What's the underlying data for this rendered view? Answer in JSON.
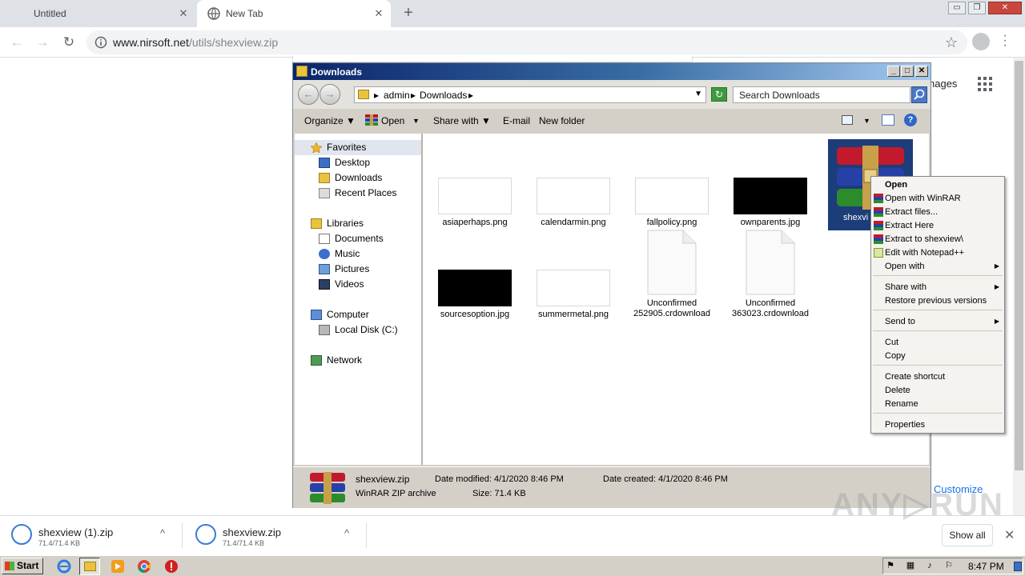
{
  "browser": {
    "tabs": [
      {
        "label": "Untitled"
      },
      {
        "label": "New Tab"
      }
    ],
    "close_glyph": "✕",
    "new_tab_glyph": "+",
    "window_buttons": {
      "minimize": "▭",
      "maximize": "❐",
      "close": "✕"
    },
    "nav": {
      "back": "←",
      "forward": "→",
      "reload": "↻",
      "star": "☆"
    },
    "url_host": "www.nirsoft.net",
    "url_path": "/utils/shexview.zip"
  },
  "ntp": {
    "images_partial": "nages",
    "customize": "Customize"
  },
  "explorer": {
    "title": "Downloads",
    "caption_buttons": {
      "minimize": "_",
      "maximize": "□",
      "close": "✕"
    },
    "breadcrumb": [
      "admin",
      "Downloads"
    ],
    "breadcrumb_sep": "▸",
    "search_placeholder": "Search Downloads",
    "commands": {
      "organize": "Organize ▼",
      "open": "Open",
      "dropdown": "▼",
      "share": "Share with ▼",
      "email": "E-mail",
      "new_folder": "New folder",
      "help": "?"
    },
    "nav": {
      "favorites": "Favorites",
      "desktop": "Desktop",
      "downloads": "Downloads",
      "recent": "Recent Places",
      "libraries": "Libraries",
      "documents": "Documents",
      "music": "Music",
      "pictures": "Pictures",
      "videos": "Videos",
      "computer": "Computer",
      "local_disk": "Local Disk (C:)",
      "network": "Network"
    },
    "files": [
      {
        "name": "asiaperhaps.png"
      },
      {
        "name": "calendarmin.png"
      },
      {
        "name": "fallpolicy.png"
      },
      {
        "name": "ownparents.jpg"
      },
      {
        "name": "sourcesoption.jpg"
      },
      {
        "name": "summermetal.png"
      },
      {
        "name_line1": "Unconfirmed",
        "name_line2": "252905.crdownload"
      },
      {
        "name_line1": "Unconfirmed",
        "name_line2": "363023.crdownload"
      }
    ],
    "selected_file_partial": "shexvi",
    "details": {
      "name": "shexview.zip",
      "type": "WinRAR ZIP archive",
      "date_modified": "Date modified: 4/1/2020 8:46 PM",
      "size": "Size: 71.4 KB",
      "date_created": "Date created: 4/1/2020 8:46 PM"
    }
  },
  "context_menu": {
    "open": "Open",
    "open_winrar": "Open with WinRAR",
    "extract_files": "Extract files...",
    "extract_here": "Extract Here",
    "extract_to": "Extract to shexview\\",
    "edit_notepad": "Edit with Notepad++",
    "open_with": "Open with",
    "share_with": "Share with",
    "restore": "Restore previous versions",
    "send_to": "Send to",
    "cut": "Cut",
    "copy": "Copy",
    "create_shortcut": "Create shortcut",
    "delete": "Delete",
    "rename": "Rename",
    "properties": "Properties",
    "submenu_arrow": "▶"
  },
  "downloads": [
    {
      "name": "shexview (1).zip",
      "size": "71.4/71.4 KB"
    },
    {
      "name": "shexview.zip",
      "size": "71.4/71.4 KB"
    }
  ],
  "shelf": {
    "show_all": "Show all",
    "close": "✕",
    "chevron": "^"
  },
  "watermark": "ANY▷RUN",
  "taskbar": {
    "start": "Start",
    "time": "8:47 PM"
  }
}
